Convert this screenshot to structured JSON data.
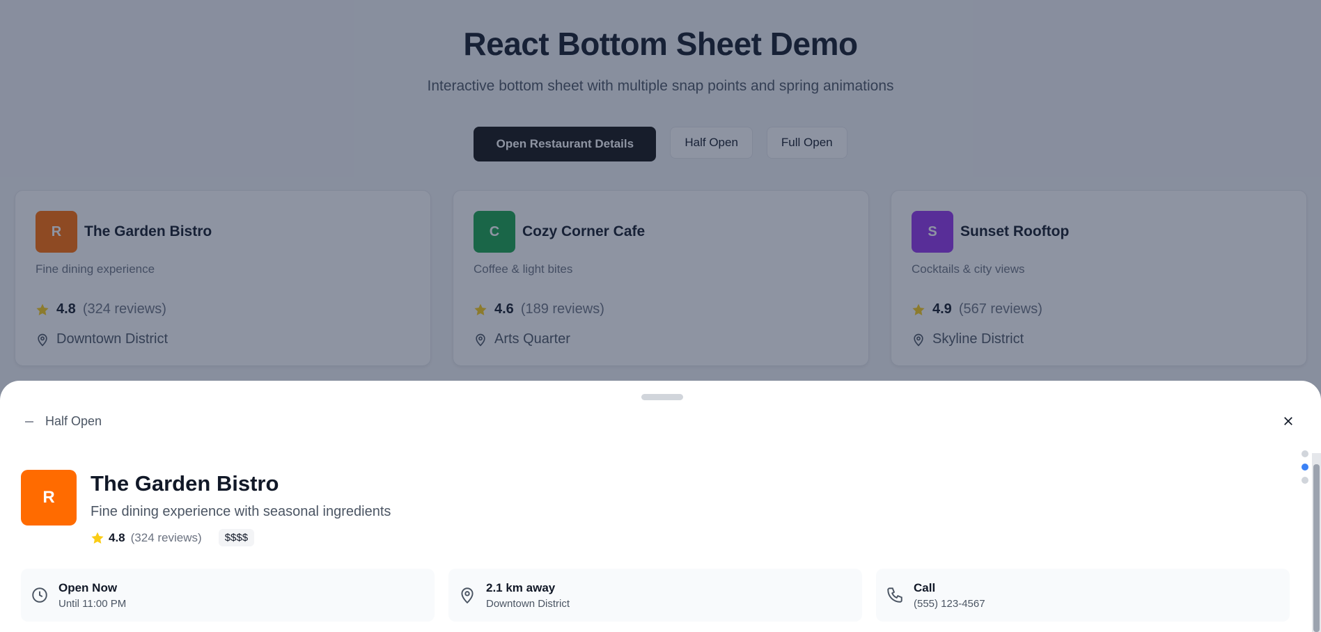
{
  "header": {
    "title": "React Bottom Sheet Demo",
    "subtitle": "Interactive bottom sheet with multiple snap points and spring animations"
  },
  "actions": {
    "open_details": "Open Restaurant Details",
    "half_open": "Half Open",
    "full_open": "Full Open"
  },
  "restaurants": [
    {
      "initial": "R",
      "name": "The Garden Bistro",
      "description": "Fine dining experience",
      "rating": "4.8",
      "reviews": "(324 reviews)",
      "location": "Downtown District",
      "color": "#ff6b00"
    },
    {
      "initial": "C",
      "name": "Cozy Corner Cafe",
      "description": "Coffee & light bites",
      "rating": "4.6",
      "reviews": "(189 reviews)",
      "location": "Arts Quarter",
      "color": "#16a34a"
    },
    {
      "initial": "S",
      "name": "Sunset Rooftop",
      "description": "Cocktails & city views",
      "rating": "4.9",
      "reviews": "(567 reviews)",
      "location": "Skyline District",
      "color": "#9333ea"
    }
  ],
  "sheet": {
    "state_label": "Half Open",
    "snap_points": 3,
    "active_snap_index": 1,
    "detail": {
      "initial": "R",
      "name": "The Garden Bistro",
      "description": "Fine dining experience with seasonal ingredients",
      "rating": "4.8",
      "reviews": "(324 reviews)",
      "price": "$$$$"
    },
    "info": [
      {
        "icon": "clock-icon",
        "title": "Open Now",
        "subtitle": "Until 11:00 PM"
      },
      {
        "icon": "map-pin-icon",
        "title": "2.1 km away",
        "subtitle": "Downtown District"
      },
      {
        "icon": "phone-icon",
        "title": "Call",
        "subtitle": "(555) 123-4567"
      }
    ]
  },
  "colors": {
    "accent": "#ff6b00",
    "star": "#facc15",
    "active_dot": "#3b82f6"
  }
}
